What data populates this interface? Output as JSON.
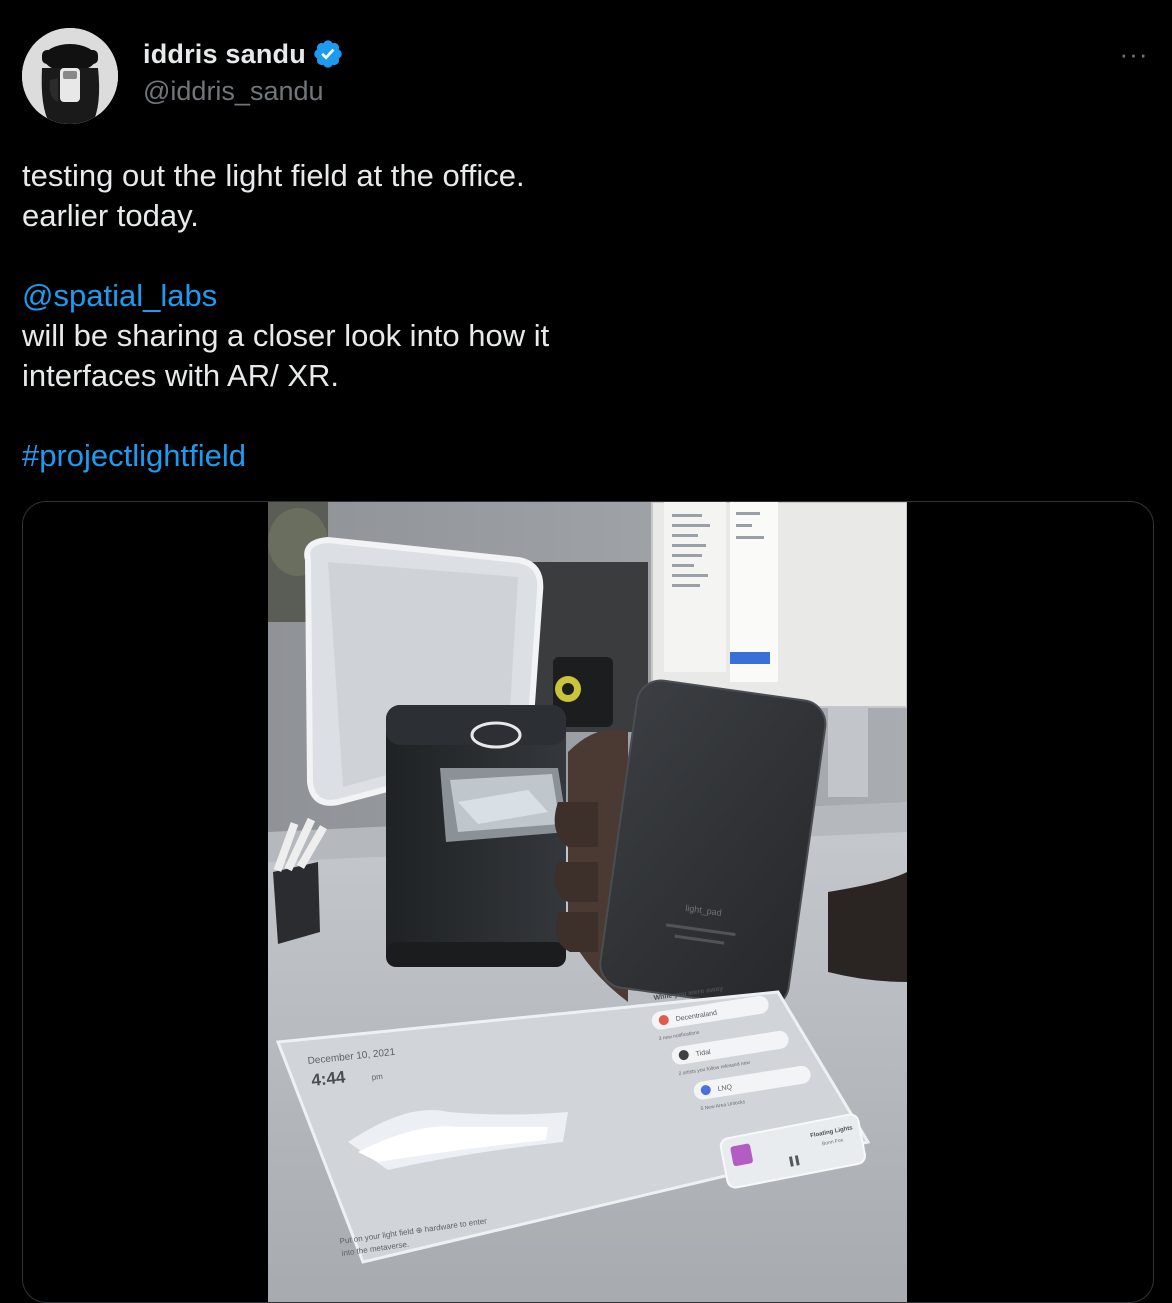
{
  "author": {
    "display_name": "iddris sandu",
    "handle": "@iddris_sandu",
    "verified": true
  },
  "menu": {
    "more_icon": "more-horizontal-icon",
    "more_label": "···"
  },
  "tweet": {
    "line1": "testing out the light field at the office.",
    "line2": "earlier today.",
    "mention": "@spatial_labs",
    "line3": "will be sharing a closer look into how it",
    "line4": "interfaces with AR/ XR.",
    "hashtag": "#projectlightfield"
  },
  "media": {
    "type": "video",
    "projected_ui": {
      "date": "December 10, 2021",
      "time": "4:44",
      "time_suffix": "pm",
      "prompt_line1": "Put on your light field ⊕ hardware to enter",
      "prompt_line2": "into the metaverse.",
      "list_heading": "While you were away",
      "items": [
        {
          "label": "Decentraland",
          "sub": "3 new notifications"
        },
        {
          "label": "Tidal",
          "sub": "2 artists you follow released new"
        },
        {
          "label": "LNQ",
          "sub": "5 New Area Unlocks"
        }
      ],
      "now_playing_title": "Floating Lights",
      "now_playing_artist": "Bonn Fox",
      "hardware_label": "light_pad"
    }
  },
  "colors": {
    "background": "#000000",
    "text_primary": "#e7e9ea",
    "text_secondary": "#71767b",
    "link": "#1d9bf0",
    "verified_badge": "#1d9bf0",
    "card_border": "#2f3336"
  }
}
